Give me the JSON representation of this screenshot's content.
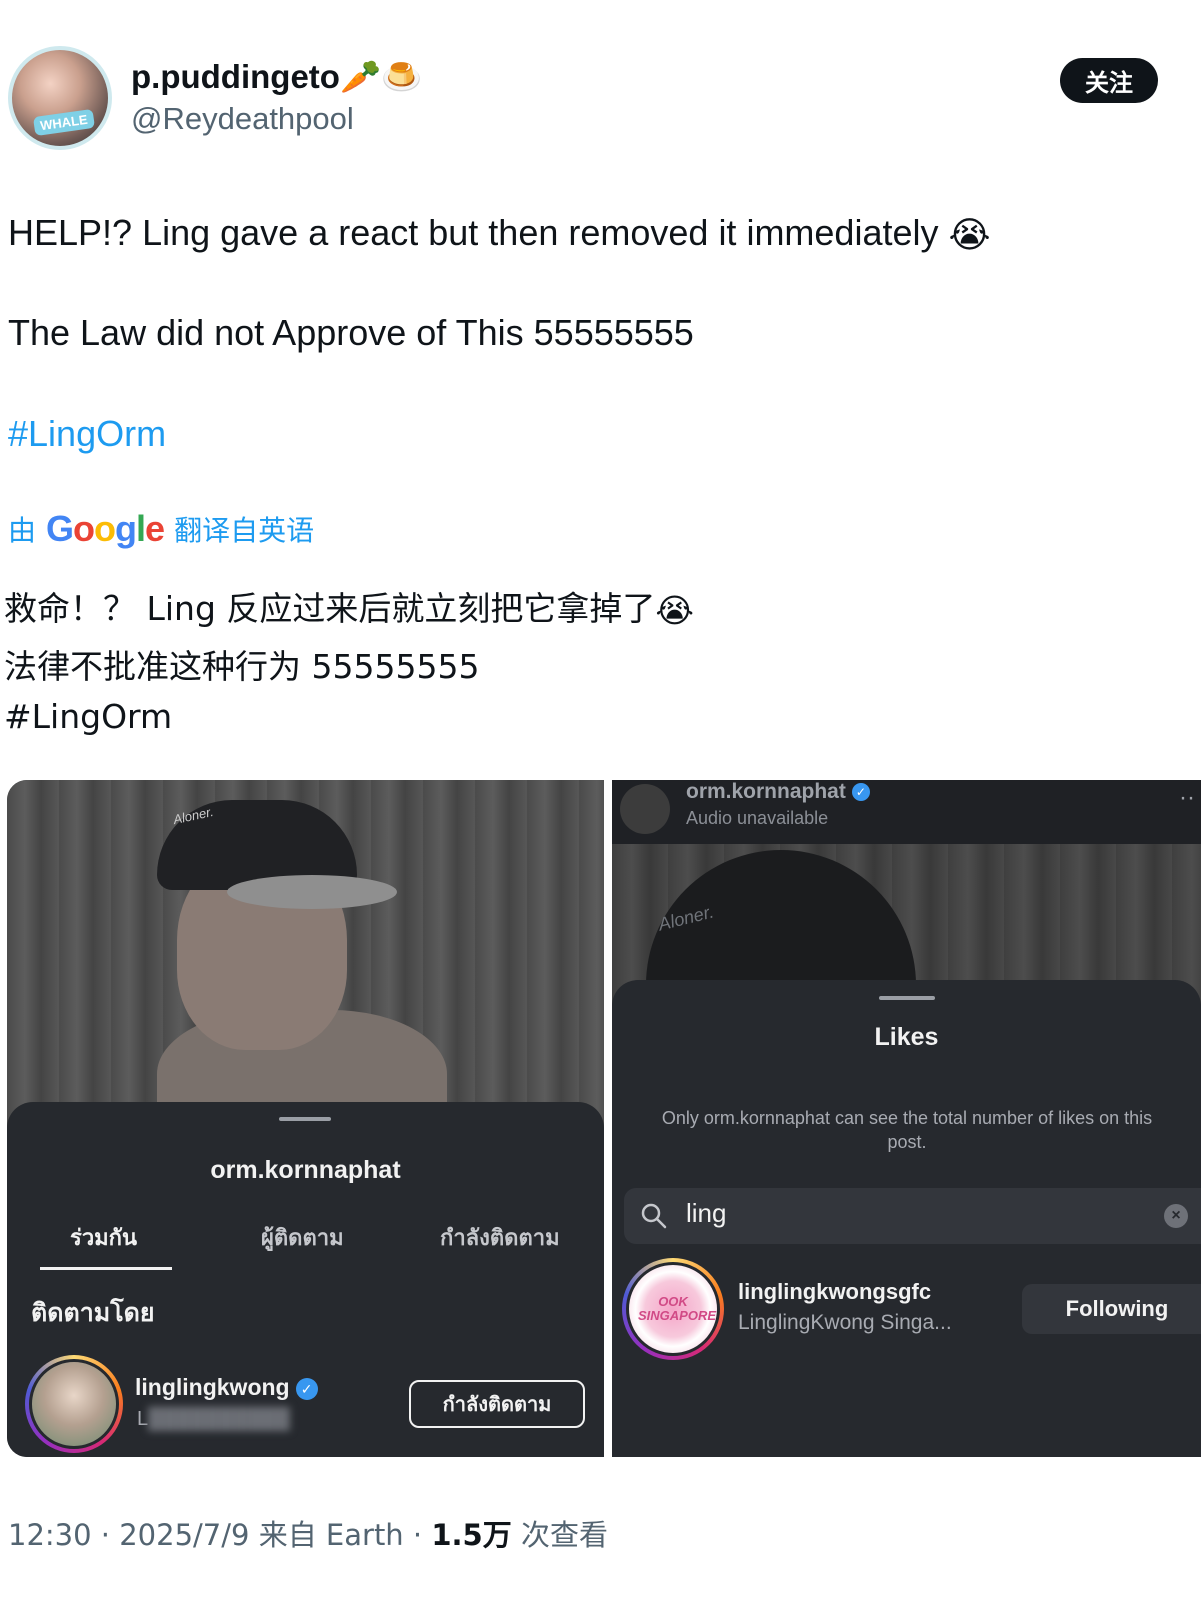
{
  "author": {
    "display_name": "p.puddingeto",
    "name_emojis": "🥕🍮",
    "handle": "@Reydeathpool",
    "avatar_badge": "WHALE"
  },
  "follow_button": "关注",
  "tweet": {
    "line1": "HELP!? Ling gave a react but then removed it immediately",
    "line1_emoji": "😭",
    "line2": "The Law did not Approve of This 55555555",
    "hashtag": "#LingOrm"
  },
  "translation": {
    "prefix": "由",
    "provider": "Google",
    "suffix": "翻译自英语",
    "line1": "救命！？ Ling 反应过来后就立刻把它拿掉了",
    "line1_emoji": "😭",
    "line2": "法律不批准这种行为 55555555",
    "hashtag": "#LingOrm"
  },
  "left_screenshot": {
    "cap_text": "Aloner.",
    "profile_name": "orm.kornnaphat",
    "tabs": [
      "ร่วมกัน",
      "ผู้ติดตาม",
      "กำลังติดตาม"
    ],
    "active_tab": 0,
    "section_label": "ติดตามโดย",
    "user": {
      "username": "linglingkwong",
      "verified": true,
      "subtitle": "L"
    },
    "action_button": "กำลังติดตาม"
  },
  "right_screenshot": {
    "top_name": "orm.kornnaphat",
    "top_sub": "Audio unavailable",
    "cap_text": "Aloner.",
    "sheet_title": "Likes",
    "note": "Only orm.kornnaphat can see the total number of likes on this post.",
    "search_value": "ling",
    "result": {
      "username": "linglingkwongsgfc",
      "fullname": "LinglingKwong Singa...",
      "avatar_text": "OOK SINGAPORE",
      "button": "Following"
    }
  },
  "meta": {
    "time": "12:30",
    "date": "2025/7/9",
    "source": "来自 Earth",
    "views": "1.5万",
    "views_label": "次查看"
  },
  "colors": {
    "accent": "#1d9bf0",
    "text": "#0f1419",
    "muted": "#536471",
    "ig_dark": "#26292e"
  }
}
